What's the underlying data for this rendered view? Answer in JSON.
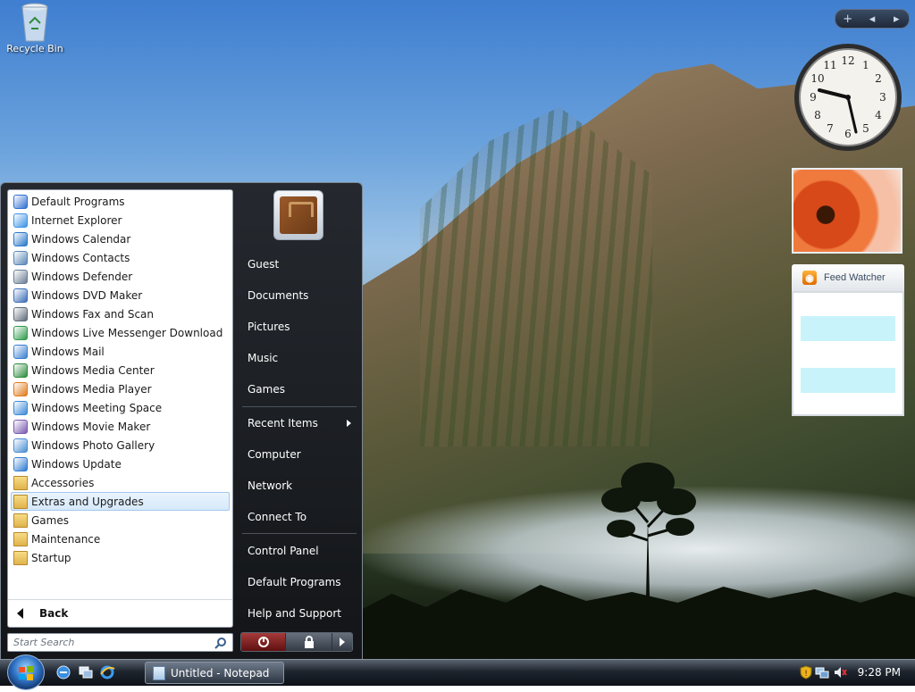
{
  "desktop": {
    "icons": [
      {
        "label": "Recycle Bin",
        "icon": "recycle-bin-icon"
      }
    ]
  },
  "sidebar": {
    "controls": [
      "+",
      "◂",
      "▸"
    ],
    "clock_time": "9:28",
    "feed_watcher": {
      "title": "Feed Watcher",
      "icon": "rss-icon"
    }
  },
  "start_menu": {
    "programs": [
      {
        "label": "Default Programs",
        "icon": "default-programs-icon"
      },
      {
        "label": "Internet Explorer",
        "icon": "internet-explorer-icon"
      },
      {
        "label": "Windows Calendar",
        "icon": "calendar-icon"
      },
      {
        "label": "Windows Contacts",
        "icon": "contacts-icon"
      },
      {
        "label": "Windows Defender",
        "icon": "defender-icon"
      },
      {
        "label": "Windows DVD Maker",
        "icon": "dvd-maker-icon"
      },
      {
        "label": "Windows Fax and Scan",
        "icon": "fax-scan-icon"
      },
      {
        "label": "Windows Live Messenger Download",
        "icon": "messenger-icon"
      },
      {
        "label": "Windows Mail",
        "icon": "mail-icon"
      },
      {
        "label": "Windows Media Center",
        "icon": "media-center-icon"
      },
      {
        "label": "Windows Media Player",
        "icon": "media-player-icon"
      },
      {
        "label": "Windows Meeting Space",
        "icon": "meeting-space-icon"
      },
      {
        "label": "Windows Movie Maker",
        "icon": "movie-maker-icon"
      },
      {
        "label": "Windows Photo Gallery",
        "icon": "photo-gallery-icon"
      },
      {
        "label": "Windows Update",
        "icon": "windows-update-icon"
      },
      {
        "label": "Accessories",
        "icon": "folder-icon"
      },
      {
        "label": "Extras and Upgrades",
        "icon": "folder-icon",
        "highlighted": true
      },
      {
        "label": "Games",
        "icon": "folder-icon"
      },
      {
        "label": "Maintenance",
        "icon": "folder-icon"
      },
      {
        "label": "Startup",
        "icon": "folder-icon"
      }
    ],
    "back_label": "Back",
    "search_placeholder": "Start Search",
    "right_links": [
      {
        "label": "Guest"
      },
      {
        "label": "Documents"
      },
      {
        "label": "Pictures"
      },
      {
        "label": "Music"
      },
      {
        "label": "Games"
      },
      {
        "label": "Recent Items",
        "submenu": true
      },
      {
        "label": "Computer"
      },
      {
        "label": "Network"
      },
      {
        "label": "Connect To"
      },
      {
        "label": "Control Panel"
      },
      {
        "label": "Default Programs"
      },
      {
        "label": "Help and Support"
      }
    ]
  },
  "taskbar": {
    "quick_launch": [
      "windows-explorer-icon",
      "switch-windows-icon",
      "internet-explorer-icon"
    ],
    "tasks": [
      {
        "label": "Untitled - Notepad",
        "icon": "notepad-icon"
      }
    ],
    "tray_icons": [
      "security-shield-icon",
      "network-icon",
      "volume-muted-icon"
    ],
    "clock": "9:28 PM"
  },
  "colors": {
    "highlight": "#d6e9fa",
    "start_menu_dark": "#1b1e22",
    "taskbar": "#1e252e",
    "feed_row": "#c9f3fb"
  }
}
